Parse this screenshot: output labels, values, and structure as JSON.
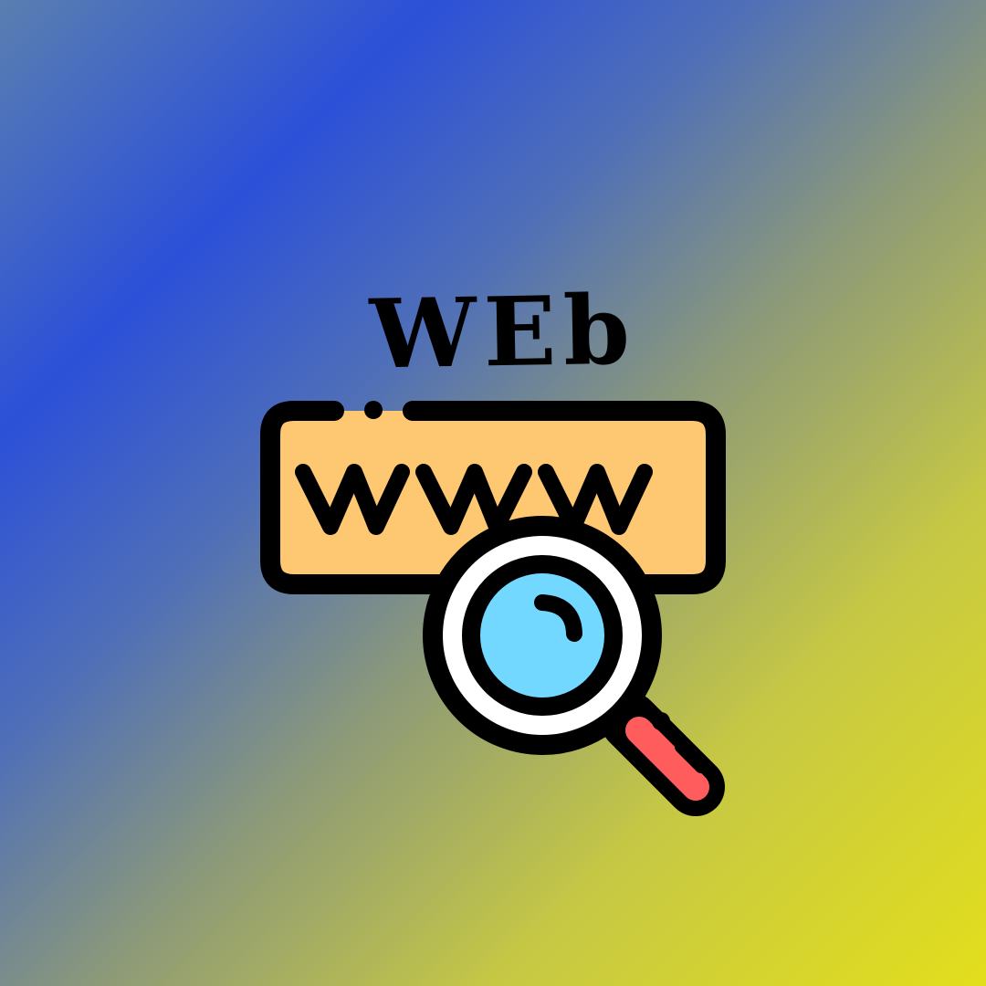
{
  "title": "WEb",
  "address_bar": {
    "text": "www"
  },
  "colors": {
    "background_start": "#2c50d8",
    "background_end": "#e3de1c",
    "bar_fill": "#fec771",
    "lens_fill": "#72d8ff",
    "handle_fill": "#ff5d5d",
    "outline": "#000000"
  },
  "icons": {
    "search": "magnifying-glass-icon",
    "web": "address-bar-icon"
  }
}
